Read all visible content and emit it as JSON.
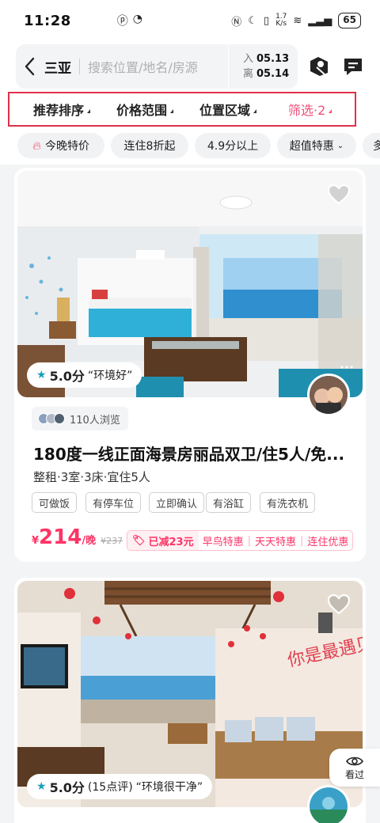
{
  "status_bar": {
    "time": "11:28",
    "net_speed_top": "1.7",
    "net_speed_bottom": "K/s",
    "battery": "65"
  },
  "header": {
    "city": "三亚",
    "search_placeholder": "搜索位置/地名/房源",
    "checkin_label": "入",
    "checkin_date": "05.13",
    "checkout_label": "离",
    "checkout_date": "05.14",
    "map_icon": "map-pin-icon",
    "message_icon": "message-icon"
  },
  "filters": {
    "sort": "推荐排序",
    "price": "价格范围",
    "location": "位置区域",
    "more": "筛选·2"
  },
  "quick_tags": [
    "今晚特价",
    "连住8折起",
    "4.9分以上",
    "超值特惠",
    "多"
  ],
  "listings": [
    {
      "score": "5.0分",
      "review_count": "",
      "score_comment": "“环境好”",
      "views": "110人浏览",
      "title": "180度一线正面海景房丽品双卫/住5人/免...",
      "subtitle": "整租·3室·3床·宜住5人",
      "amenities": [
        "可做饭",
        "有停车位",
        "立即确认",
        "有浴缸",
        "有洗衣机"
      ],
      "currency": "¥",
      "price": "214",
      "price_unit": "/晚",
      "original_price": "¥237",
      "discount": "已减23元",
      "promos": [
        "早鸟特惠",
        "天天特惠",
        "连住优惠"
      ]
    },
    {
      "score": "5.0分",
      "review_count": "(15点评)",
      "score_comment": "“环境很干净”",
      "wall_text": "你是最遇见"
    }
  ],
  "seen_button": "看过",
  "colors": {
    "accent": "#ff3366",
    "highlight_outline": "#e0304a",
    "star": "#19a0b8"
  }
}
